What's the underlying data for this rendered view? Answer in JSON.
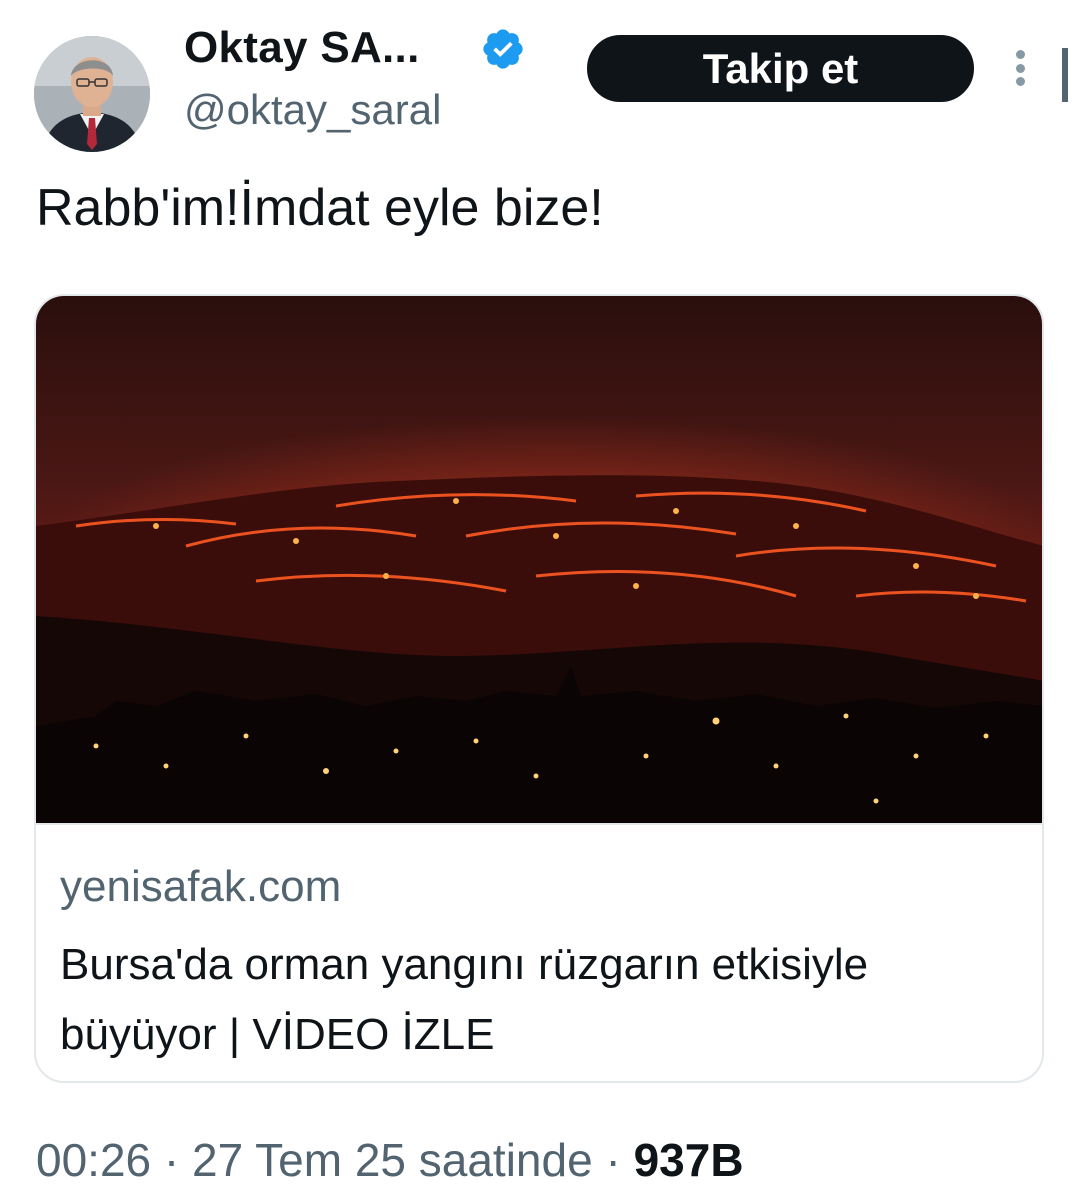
{
  "author": {
    "display_name": "Oktay SA...",
    "handle": "@oktay_saral",
    "verified_icon": "verified-badge-icon",
    "follow_label": "Takip et",
    "more_icon": "more-vertical-icon"
  },
  "tweet": {
    "text": "Rabb'im!İmdat eyle bize!"
  },
  "link_card": {
    "image_icon": "forest-fire-photo",
    "domain": "yenisafak.com",
    "title": "Bursa'da orman yangını rüzgarın etkisiyle büyüyor | VİDEO İZLE"
  },
  "meta": {
    "time": "00:26",
    "separator": "·",
    "date": "27 Tem 25 saatinde",
    "views": "937B"
  },
  "colors": {
    "text_primary": "#0f1419",
    "text_secondary": "#536471",
    "verified_blue": "#1d9bf0",
    "button_bg": "#0f1419",
    "card_border": "#e3e8eb"
  }
}
